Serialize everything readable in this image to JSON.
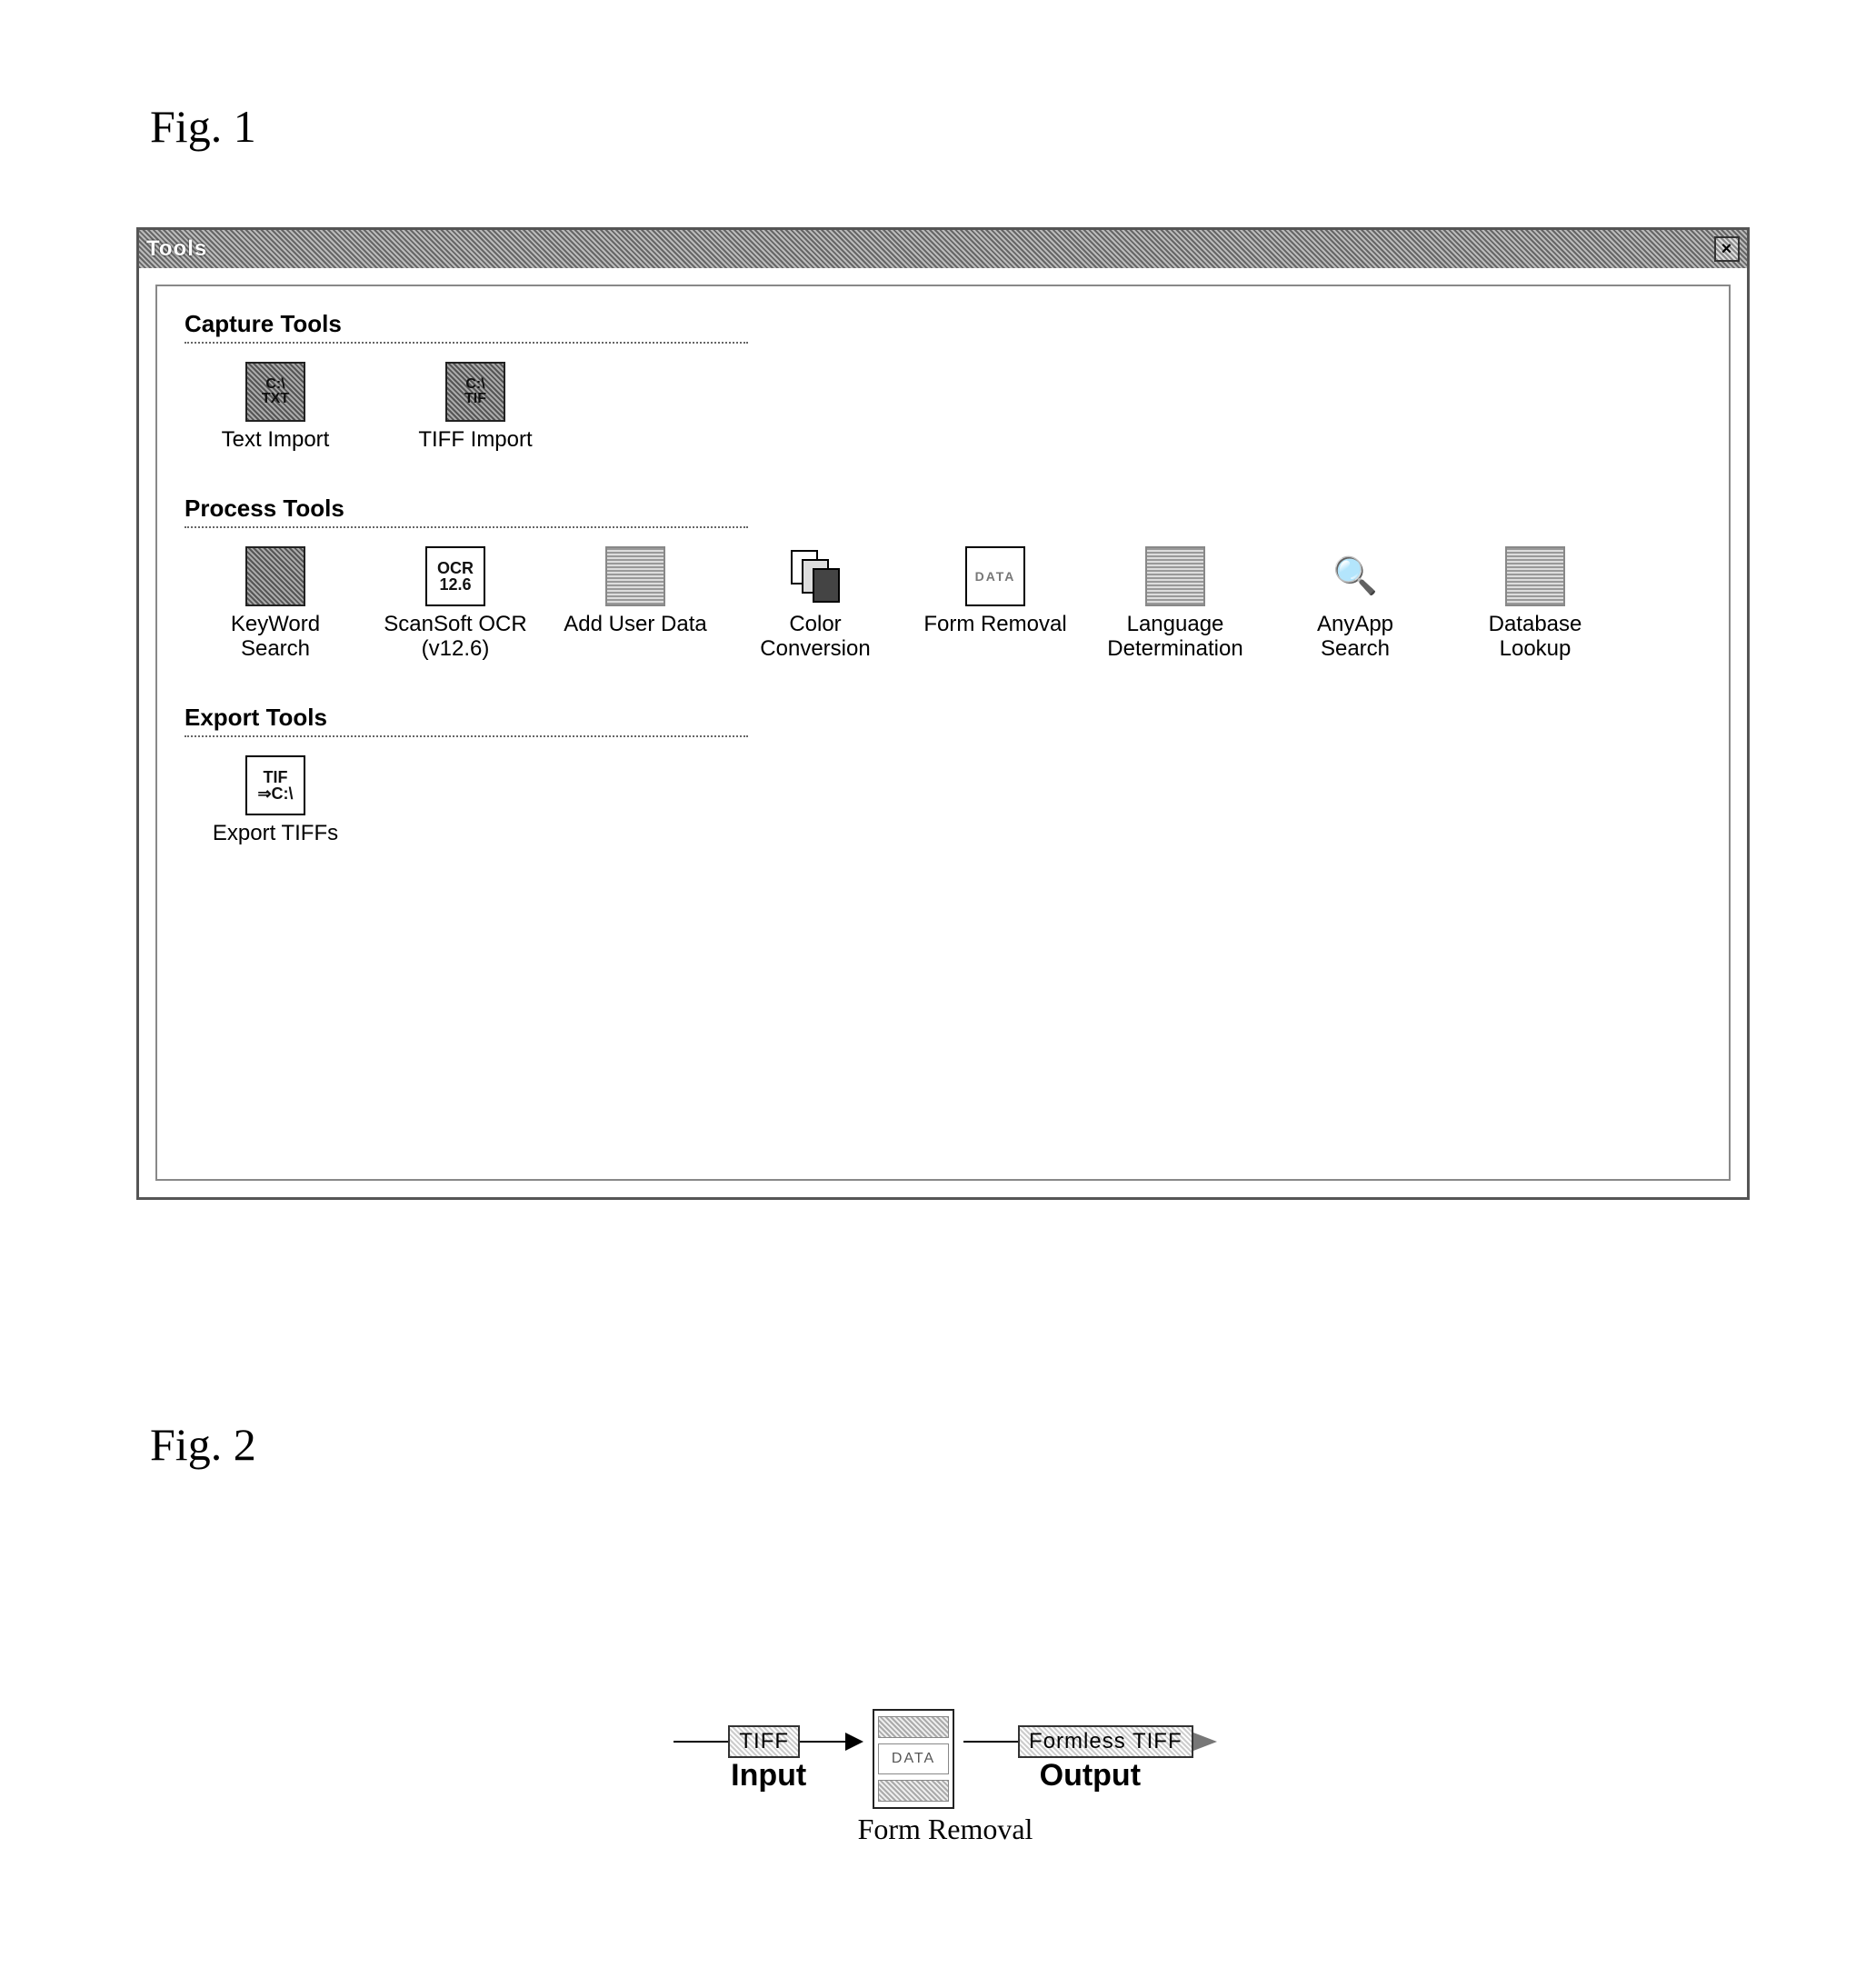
{
  "fig1_label": "Fig. 1",
  "fig2_label": "Fig. 2",
  "window": {
    "title": "Tools",
    "close": "×",
    "sections": {
      "capture": {
        "header": "Capture Tools",
        "items": [
          {
            "name": "text-import",
            "label": "Text Import",
            "icon_text": "C:\\\nTXT"
          },
          {
            "name": "tiff-import",
            "label": "TIFF Import",
            "icon_text": "C:\\\nTIF"
          }
        ]
      },
      "process": {
        "header": "Process Tools",
        "items": [
          {
            "name": "keyword-search",
            "label": "KeyWord\nSearch",
            "icon_text": ""
          },
          {
            "name": "scansoft-ocr",
            "label": "ScanSoft OCR\n(v12.6)",
            "icon_text": "OCR\n12.6",
            "plain": true
          },
          {
            "name": "add-user-data",
            "label": "Add User Data",
            "icon_text": "",
            "grey": true
          },
          {
            "name": "color-conversion",
            "label": "Color\nConversion",
            "icon_text": "",
            "noborder": true
          },
          {
            "name": "form-removal",
            "label": "Form Removal",
            "icon_text": "DATA",
            "plain": true
          },
          {
            "name": "language-determination",
            "label": "Language\nDetermination",
            "icon_text": "",
            "grey": true
          },
          {
            "name": "anyapp-search",
            "label": "AnyApp\nSearch",
            "icon_text": "",
            "noborder": true
          },
          {
            "name": "database-lookup",
            "label": "Database\nLookup",
            "icon_text": "",
            "grey": true
          }
        ]
      },
      "export": {
        "header": "Export Tools",
        "items": [
          {
            "name": "export-tiffs",
            "label": "Export TIFFs",
            "icon_text": "TIF\n⇒C:\\",
            "plain": true
          }
        ]
      }
    }
  },
  "fig2": {
    "input_chip": "TIFF",
    "input_label": "Input",
    "center_label": "Form Removal",
    "center_icon_text": "DATA",
    "output_chip": "Formless TIFF",
    "output_label": "Output"
  }
}
